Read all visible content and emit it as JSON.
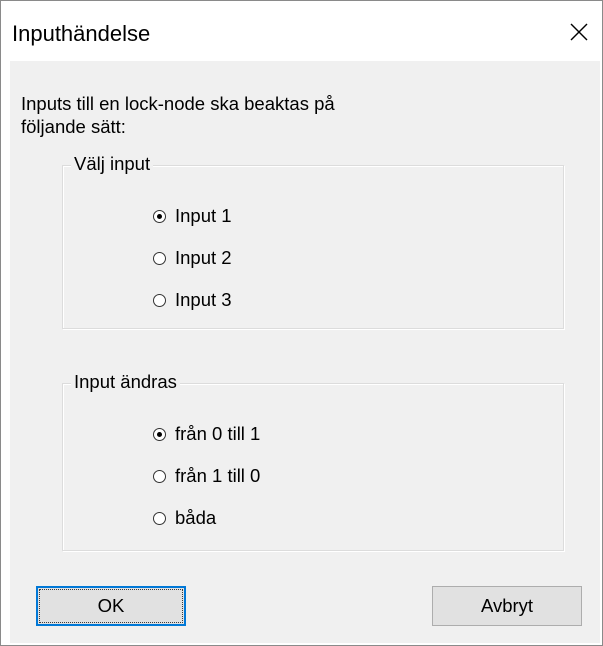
{
  "window": {
    "title": "Inputhändelse",
    "close_icon": "close-icon"
  },
  "intro": {
    "line1": "Inputs till en lock-node ska beaktas på",
    "line2": "följande sätt:"
  },
  "select_input_group": {
    "legend": "Välj input",
    "options": [
      {
        "label": "Input 1",
        "selected": true
      },
      {
        "label": "Input 2",
        "selected": false
      },
      {
        "label": "Input 3",
        "selected": false
      }
    ]
  },
  "input_change_group": {
    "legend": "Input ändras",
    "options": [
      {
        "label": "från 0 till 1",
        "selected": true
      },
      {
        "label": "från 1 till 0",
        "selected": false
      },
      {
        "label": "båda",
        "selected": false
      }
    ]
  },
  "buttons": {
    "ok_label": "OK",
    "cancel_label": "Avbryt"
  },
  "colors": {
    "dialog_background": "#f0f0f0",
    "titlebar_background": "#ffffff",
    "default_button_border": "#0078d7",
    "button_face": "#e1e1e1"
  }
}
